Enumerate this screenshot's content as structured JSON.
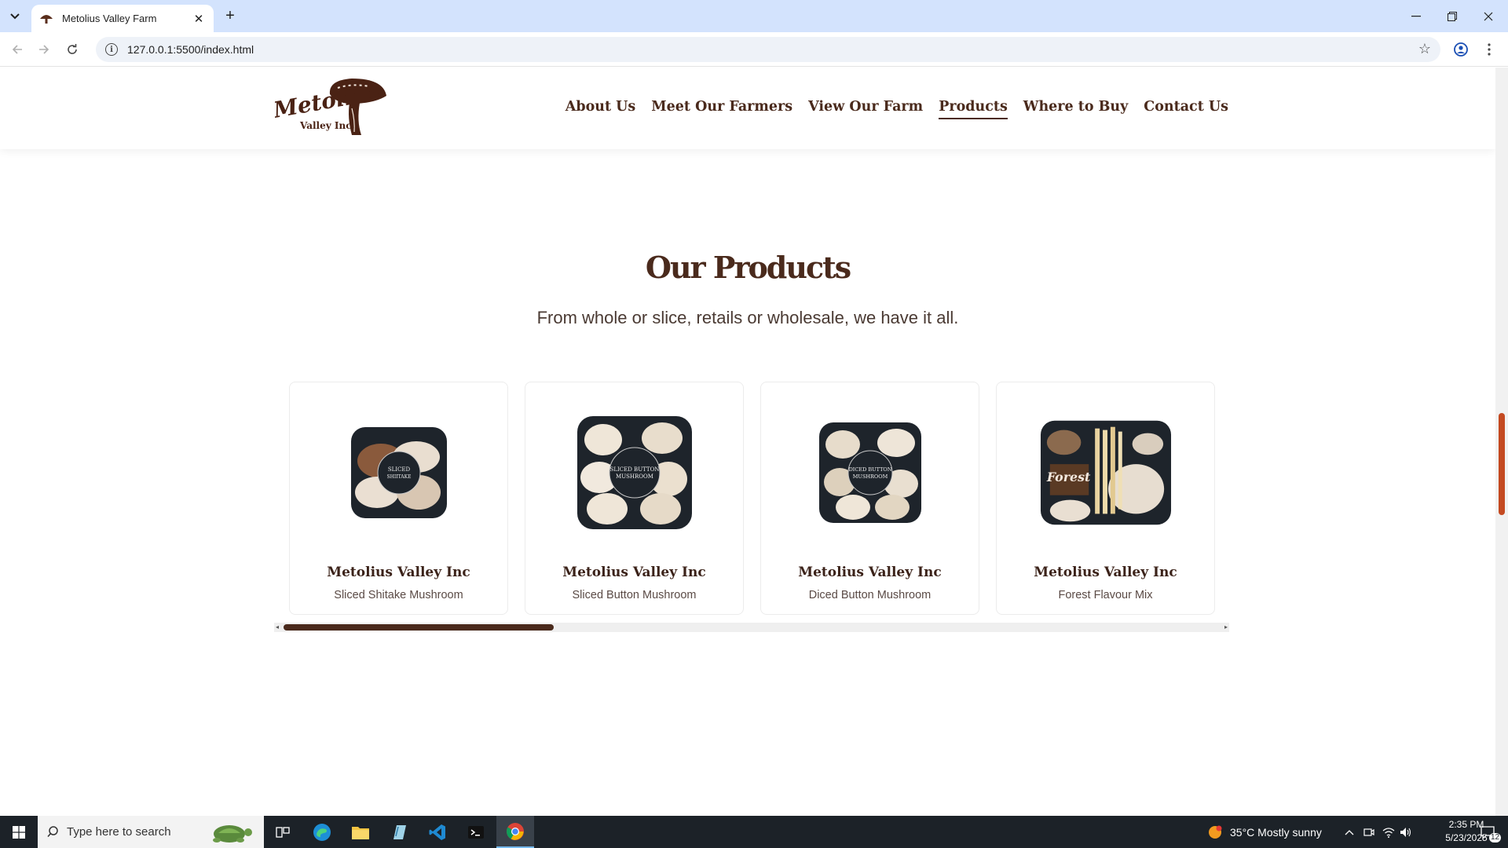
{
  "browser": {
    "tab_title": "Metolius Valley Farm",
    "new_tab_symbol": "+",
    "url": "127.0.0.1:5500/index.html"
  },
  "site": {
    "nav": [
      {
        "label": "About Us",
        "active": false
      },
      {
        "label": "Meet Our Farmers",
        "active": false
      },
      {
        "label": "View Our Farm",
        "active": false
      },
      {
        "label": "Products",
        "active": true
      },
      {
        "label": "Where to Buy",
        "active": false
      },
      {
        "label": "Contact Us",
        "active": false
      }
    ],
    "section_title": "Our Products",
    "section_subtitle": "From whole or slice, retails or wholesale, we have it all.",
    "products": [
      {
        "brand": "Metolius Valley Inc",
        "name": "Sliced Shitake Mushroom"
      },
      {
        "brand": "Metolius Valley Inc",
        "name": "Sliced Button Mushroom"
      },
      {
        "brand": "Metolius Valley Inc",
        "name": "Diced Button Mushroom"
      },
      {
        "brand": "Metolius Valley Inc",
        "name": "Forest Flavour Mix"
      }
    ],
    "accent_color": "#4a2a1c"
  },
  "taskbar": {
    "search_placeholder": "Type here to search",
    "weather": "35°C  Mostly sunny",
    "time": "2:35 PM",
    "date": "5/23/2025",
    "notification_count": "12"
  }
}
